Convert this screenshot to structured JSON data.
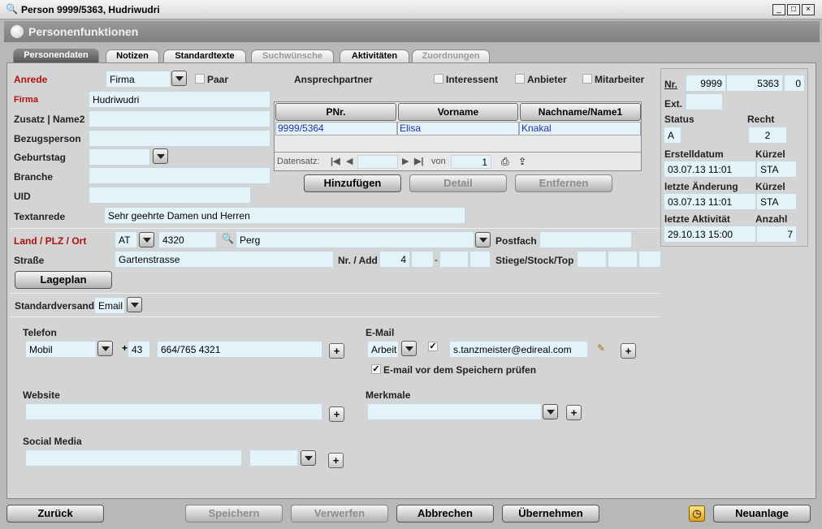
{
  "window": {
    "title": "Person 9999/5363, Hudriwudri",
    "minimize": "_",
    "maximize": "□",
    "close": "×"
  },
  "header": {
    "title": "Personenfunktionen"
  },
  "tabs": [
    {
      "label": "Personendaten"
    },
    {
      "label": "Notizen"
    },
    {
      "label": "Standardtexte"
    },
    {
      "label": "Suchwünsche"
    },
    {
      "label": "Aktivitäten"
    },
    {
      "label": "Zuordnungen"
    }
  ],
  "form": {
    "anrede_label": "Anrede",
    "anrede_value": "Firma",
    "paar_label": "Paar",
    "firma_label": "Firma",
    "firma_value": "Hudriwudri",
    "zusatz_label": "Zusatz | Name2",
    "bezugsperson_label": "Bezugsperson",
    "geburtstag_label": "Geburtstag",
    "branche_label": "Branche",
    "uid_label": "UID",
    "textanrede_label": "Textanrede",
    "textanrede_value": "Sehr geehrte Damen und Herren",
    "ansprechpartner_label": "Ansprechpartner",
    "interessent_label": "Interessent",
    "anbieter_label": "Anbieter",
    "mitarbeiter_label": "Mitarbeiter"
  },
  "contacts": {
    "headers": [
      "PNr.",
      "Vorname",
      "Nachname/Name1"
    ],
    "rows": [
      [
        "9999/5364",
        "Elisa",
        "Knakal"
      ]
    ],
    "datensatz_label": "Datensatz:",
    "von_label": "von",
    "von_value": "1",
    "add_label": "Hinzufügen",
    "detail_label": "Detail",
    "remove_label": "Entfernen"
  },
  "address": {
    "land_label": "Land / PLZ / Ort",
    "land_value": "AT",
    "plz_value": "4320",
    "ort_value": "Perg",
    "postfach_label": "Postfach",
    "strasse_label": "Straße",
    "strasse_value": "Gartenstrasse",
    "nr_label": "Nr. / Add",
    "nr_value": "4",
    "dash": "-",
    "stiege_label": "Stiege/Stock/Top",
    "lageplan_label": "Lageplan"
  },
  "versand": {
    "label": "Standardversand",
    "value": "Email"
  },
  "telefon": {
    "label": "Telefon",
    "type_value": "Mobil",
    "plus": "+",
    "prefix_value": "43",
    "number_value": "664/765 4321"
  },
  "email": {
    "label": "E-Mail",
    "type_value": "Arbeit",
    "address_value": "s.tanzmeister@edireal.com",
    "check_label": "E-mail vor dem Speichern prüfen"
  },
  "website": {
    "label": "Website"
  },
  "merkmale": {
    "label": "Merkmale"
  },
  "social": {
    "label": "Social Media"
  },
  "info": {
    "nr_label": "Nr.",
    "nr_value1": "9999",
    "nr_value2": "5363",
    "nr_value3": "0",
    "ext_label": "Ext.",
    "status_label": "Status",
    "status_value": "A",
    "recht_label": "Recht",
    "recht_value": "2",
    "erstelldatum_label": "Erstelldatum",
    "erstelldatum_value": "03.07.13 11:01",
    "kuerzel1_label": "Kürzel",
    "kuerzel1_value": "STA",
    "aenderung_label": "letzte Änderung",
    "aenderung_value": "03.07.13 11:01",
    "kuerzel2_label": "Kürzel",
    "kuerzel2_value": "STA",
    "aktivitaet_label": "letzte Aktivität",
    "aktivitaet_value": "29.10.13 15:00",
    "anzahl_label": "Anzahl",
    "anzahl_value": "7"
  },
  "footer": {
    "zurueck": "Zurück",
    "speichern": "Speichern",
    "verwerfen": "Verwerfen",
    "abbrechen": "Abbrechen",
    "uebernehmen": "Übernehmen",
    "neuanlage": "Neuanlage"
  }
}
